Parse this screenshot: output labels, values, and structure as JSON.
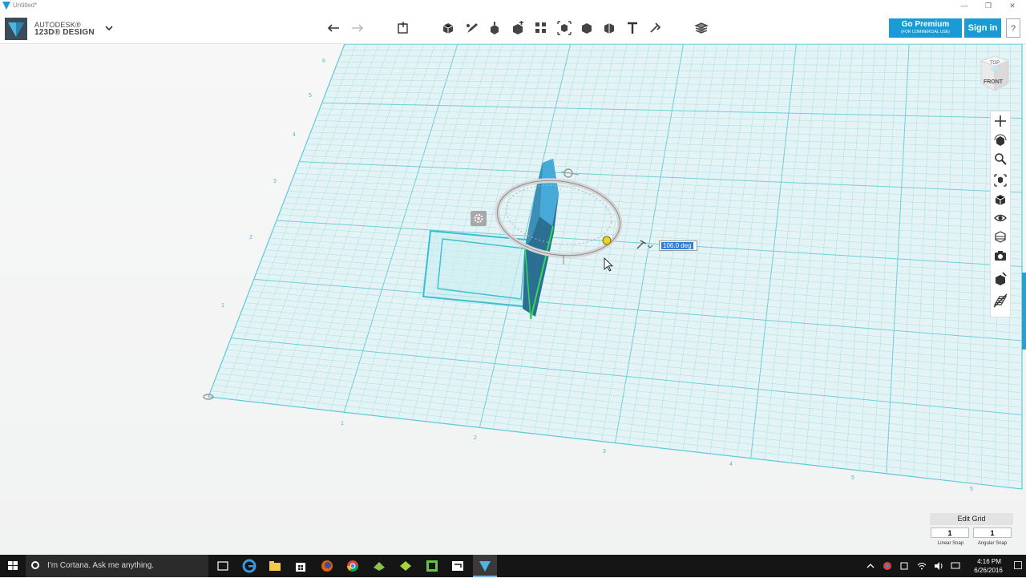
{
  "window": {
    "title": "Untitled*",
    "minimize": "—",
    "maximize": "❒",
    "close": "✕"
  },
  "brand": {
    "line1": "AUTODESK®",
    "line2": "123D® DESIGN"
  },
  "toolbar": {
    "undo": "undo-icon",
    "redo": "redo-icon",
    "transform": "transform-icon",
    "tools": [
      "primitives-icon",
      "sketch-icon",
      "construct-icon",
      "modify-icon",
      "pattern-icon",
      "grouping-icon",
      "combine-icon",
      "measure-icon",
      "text-icon",
      "snap-icon",
      "material-icon"
    ]
  },
  "account": {
    "premium_label": "Go Premium",
    "premium_sub": "(FOR COMMERCIAL USE)",
    "signin_label": "Sign in",
    "help_label": "?"
  },
  "viewcube": {
    "top": "TOP",
    "front": "FRONT"
  },
  "navbar": [
    "pan-icon",
    "orbit-icon",
    "zoom-icon",
    "fit-icon",
    "views-icon",
    "visibility-icon",
    "material-view-icon",
    "screenshot-icon",
    "snap-icon",
    "grid-icon"
  ],
  "scene": {
    "angle_input": "106.0 deg",
    "grid_x_labels": [
      "1",
      "2",
      "3",
      "4",
      "5",
      "5"
    ],
    "grid_y_labels": [
      "1",
      "2",
      "3",
      "4",
      "5",
      "6"
    ]
  },
  "grid_panel": {
    "title": "Edit Grid",
    "linear_value": "1",
    "angular_value": "1",
    "linear_label": "Linear Snap",
    "angular_label": "Angular Snap"
  },
  "taskbar": {
    "cortana_text": "I'm Cortana. Ask me anything.",
    "time": "4:16 PM",
    "date": "6/26/2016"
  },
  "colors": {
    "accent": "#1a9bd5",
    "grid": "#7fd3dc",
    "object": "#3aa0c8"
  }
}
